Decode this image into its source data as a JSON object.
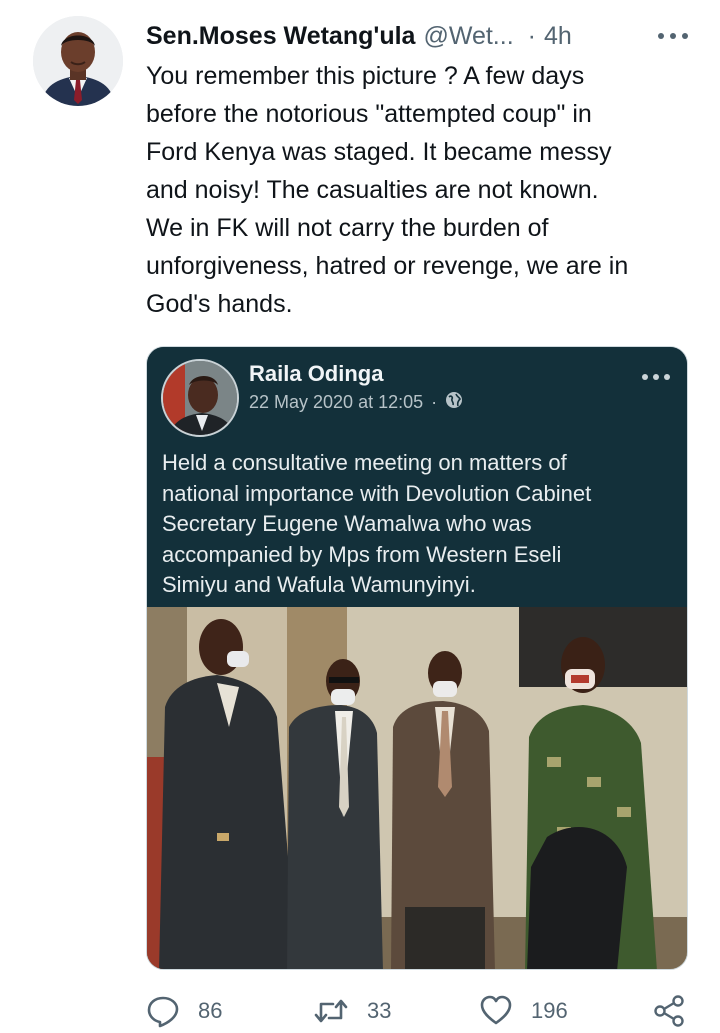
{
  "tweet": {
    "author_name": "Sen.Moses Wetang'ula",
    "handle": "@Wet...",
    "separator": "·",
    "time": "4h",
    "text": "You remember this picture ? A few days\nbefore the notorious \"attempted coup\" in\nFord Kenya was staged. It became messy\nand noisy! The casualties are not known.\nWe in FK will not carry the burden of\nunforgiveness, hatred or revenge, we are in\nGod's hands."
  },
  "embedded_post": {
    "author": "Raila Odinga",
    "date": "22 May 2020 at 12:05",
    "meta_separator": "·",
    "text": "Held a consultative meeting on matters of\nnational importance with Devolution Cabinet\nSecretary Eugene Wamalwa who was\naccompanied by Mps from Western Eseli\nSimiyu and Wafula Wamunyinyi."
  },
  "actions": {
    "replies": "86",
    "retweets": "33",
    "likes": "196"
  },
  "icons": {
    "more": "more-horizontal-icon",
    "reply": "reply-icon",
    "retweet": "retweet-icon",
    "like": "heart-icon",
    "share": "share-icon",
    "globe": "globe-icon"
  },
  "colors": {
    "text": "#0f1419",
    "muted": "#536471",
    "post_background": "#13303a"
  }
}
